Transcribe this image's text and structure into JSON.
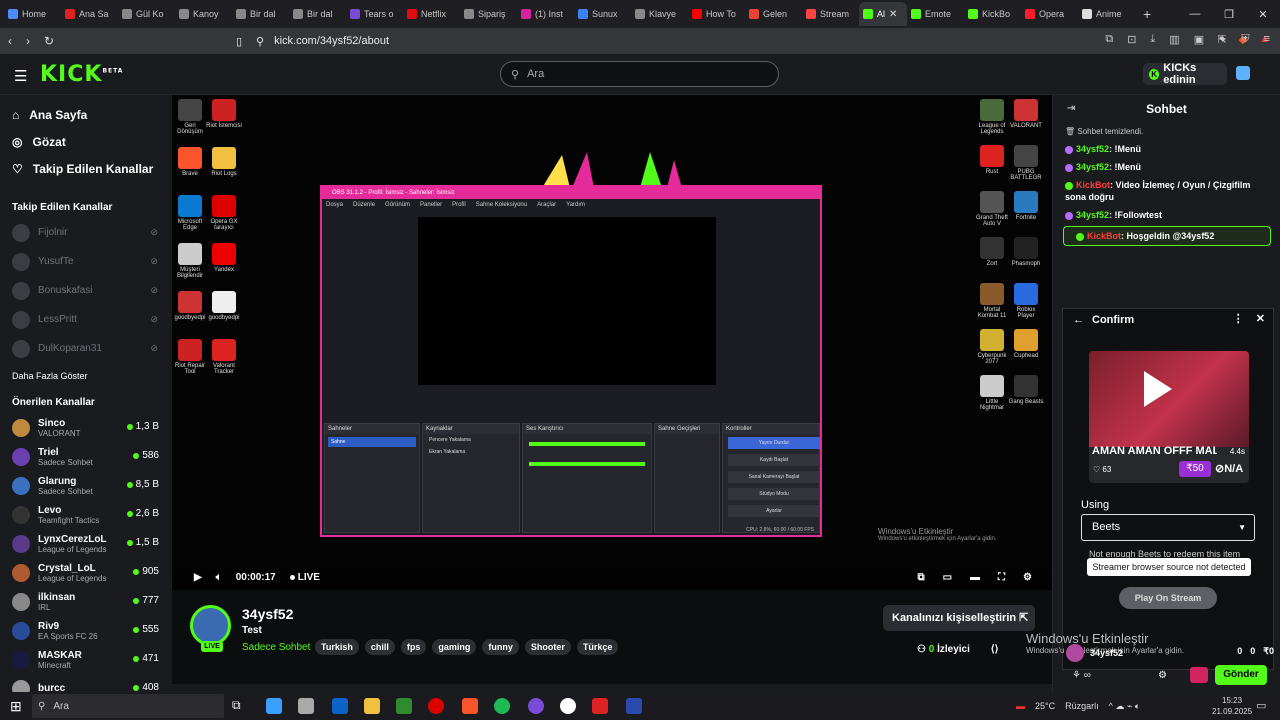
{
  "browser": {
    "tabs": [
      {
        "label": "Home",
        "color": "#4a8cff"
      },
      {
        "label": "Ana Sa",
        "color": "#d22"
      },
      {
        "label": "Gül Ko",
        "color": "#888"
      },
      {
        "label": "Kanoy",
        "color": "#888"
      },
      {
        "label": "Bir dal",
        "color": "#888"
      },
      {
        "label": "Bir dal",
        "color": "#888"
      },
      {
        "label": "Tears o",
        "color": "#7a4bd6"
      },
      {
        "label": "Netflix",
        "color": "#e50914"
      },
      {
        "label": "Sipariş",
        "color": "#888"
      },
      {
        "label": "(1) Inst",
        "color": "#d6249f"
      },
      {
        "label": "Sunux",
        "color": "#3b82f6"
      },
      {
        "label": "Klavye",
        "color": "#888"
      },
      {
        "label": "How To",
        "color": "#f00"
      },
      {
        "label": "Gelen",
        "color": "#ea4335"
      },
      {
        "label": "Stream",
        "color": "#f44"
      },
      {
        "label": "Al",
        "color": "#53fc18"
      },
      {
        "label": "Emote",
        "color": "#53fc18"
      },
      {
        "label": "KickBo",
        "color": "#53fc18"
      },
      {
        "label": "Opera",
        "color": "#ff1b2d"
      },
      {
        "label": "Anime",
        "color": "#ddd"
      }
    ],
    "url": "kick.com/34ysf52/about"
  },
  "header": {
    "logo": "KICK",
    "logo_sup": "BETA",
    "search_placeholder": "Ara",
    "kicks_button": "KICKs edinin"
  },
  "sidebar": {
    "nav": [
      {
        "icon": "⌂",
        "label": "Ana Sayfa"
      },
      {
        "icon": "◎",
        "label": "Gözat"
      },
      {
        "icon": "♡",
        "label": "Takip Edilen Kanallar"
      }
    ],
    "followed_title": "Takip Edilen Kanallar",
    "followed": [
      "Fijolnir",
      "YusufTe",
      "Bonuskafasi",
      "LessPritt",
      "DulKoparan31"
    ],
    "more_label": "Daha Fazla Göster",
    "recommended_title": "Önerilen Kanallar",
    "recommended": [
      {
        "name": "Sinco",
        "category": "VALORANT",
        "viewers": "1,3 B",
        "color": "#c08a3e"
      },
      {
        "name": "Triel",
        "category": "Sadece Sohbet",
        "viewers": "586",
        "color": "#6a3fb0"
      },
      {
        "name": "Glarung",
        "category": "Sadece Sohbet",
        "viewers": "8,5 B",
        "color": "#3a70c0"
      },
      {
        "name": "Levo",
        "category": "Teamfight Tactics",
        "viewers": "2,6 B",
        "color": "#333"
      },
      {
        "name": "LynxCerezLoL",
        "category": "League of Legends",
        "viewers": "1,5 B",
        "color": "#5a3a8a"
      },
      {
        "name": "Crystal_LoL",
        "category": "League of Legends",
        "viewers": "905",
        "color": "#b05a30"
      },
      {
        "name": "ilkinsan",
        "category": "IRL",
        "viewers": "777",
        "color": "#888"
      },
      {
        "name": "Riv9",
        "category": "EA Sports FC 26",
        "viewers": "555",
        "color": "#2a4a9a"
      },
      {
        "name": "MASKAR",
        "category": "Minecraft",
        "viewers": "471",
        "color": "#1a1a40"
      },
      {
        "name": "burcc",
        "category": "",
        "viewers": "408",
        "color": "#999"
      }
    ]
  },
  "player": {
    "time": "00:00:17",
    "live": "LIVE",
    "obs_title": "OBS 31.1.2 - Profil: İsimsiz - Sahneler: İsimsiz",
    "obs_menu": [
      "Dosya",
      "Düzenle",
      "Görünüm",
      "Paneller",
      "Profil",
      "Sahne Koleksiyonu",
      "Araçlar",
      "Yardım"
    ],
    "obs_docks": [
      "Sahneler",
      "Kaynaklar",
      "Ses Karıştırıcı",
      "Sahne Geçişleri",
      "Kontroller"
    ],
    "obs_scene": "Sahne",
    "obs_sources": [
      "Pencere Yakalama",
      "Ekran Yakalama"
    ],
    "obs_controls": [
      "Yayını Durdur",
      "Kaydı Başlat",
      "Sanal Kamerayı Başlat",
      "Stüdyo Modu",
      "Ayarlar"
    ],
    "obs_status": "CPU: 2.8%, 60.00 / 60.00 FPS",
    "desktop_left": [
      "Geri Dönüşüm",
      "Riot İstemcisi",
      "Brave",
      "Riot Logs",
      "Microsoft Edge",
      "Opera GX tarayıcı",
      "Müşteri Bilgilendir",
      "Yandex",
      "goodbyedpi",
      "goodbyedpi",
      "Riot Repair Tool",
      "Valorant Tracker"
    ],
    "desktop_right": [
      "League of Legends",
      "VALORANT",
      "Rust",
      "PUBG BATTLEGR",
      "Grand Theft Auto V",
      "Fortnite",
      "Zort",
      "Phasmoph",
      "Mortal Kombat 11",
      "Roblox Player",
      "Cyberpunk 2077",
      "Cuphead",
      "Little Nightmar",
      "Gang Beasts"
    ],
    "win_activate": "Windows'u Etkinleştir",
    "win_activate_sub": "Windows'u etkinleştirmek için Ayarlar'a gidin."
  },
  "stream": {
    "name": "34ysf52",
    "title": "Test",
    "live_badge": "LIVE",
    "category": "Sadece Sohbet",
    "tags": [
      "Turkish",
      "chill",
      "fps",
      "gaming",
      "funny",
      "Shooter",
      "Türkçe"
    ],
    "customize": "Kanalınızı kişiselleştirin",
    "viewers": "0",
    "viewers_label": "İzleyici"
  },
  "chat": {
    "title": "Sohbet",
    "cleared": "Sohbet temizlendi.",
    "messages": [
      {
        "user": "34ysf52",
        "text": ": !Menü",
        "bot": false
      },
      {
        "user": "34ysf52",
        "text": ": !Menü",
        "bot": false
      },
      {
        "user": "KickBot",
        "text": ": Video İzlemeç / Oyun / Çizgifilm sona doğru",
        "bot": true
      },
      {
        "user": "34ysf52",
        "text": ": !Followtest",
        "bot": false
      },
      {
        "user": "KickBot",
        "text": ": Hoşgeldin @34ysf52",
        "bot": true
      }
    ],
    "confirm": {
      "title": "Confirm",
      "card_title": "AMAN AMAN OFFF MALP...",
      "duration": "4.4s",
      "likes": "63",
      "price": "50",
      "na": "N/A",
      "using_label": "Using",
      "select_value": "Beets",
      "warning": "Not enough Beets to redeem this item",
      "tooltip": "Streamer browser source not detected",
      "play_button": "Play On Stream"
    },
    "footer_user": "34ysf52",
    "counts": [
      "0",
      "0",
      "0"
    ],
    "send": "Gönder"
  },
  "taskbar": {
    "search": "Ara",
    "weather": "25°C",
    "weather_text": "Rüzgarlı",
    "time": "15:23",
    "date": "21.09.2025"
  },
  "colors": {
    "accent": "#53fc18",
    "obs_border": "#e52b9a",
    "bot": "#ff3b3b"
  }
}
